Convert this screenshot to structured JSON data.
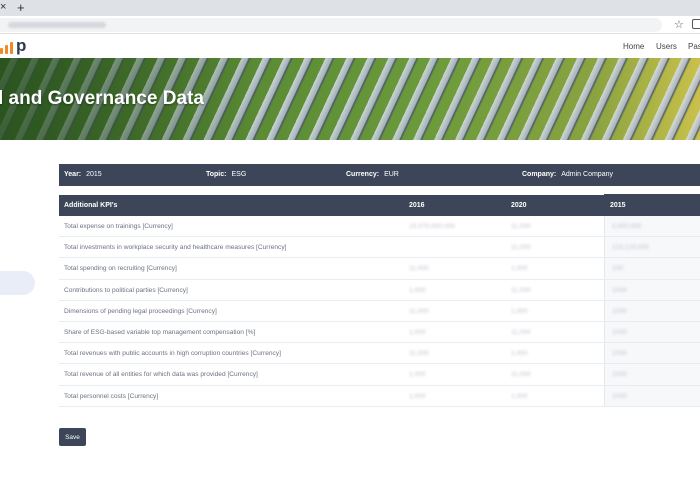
{
  "browser": {
    "close_glyph": "×",
    "newtab_glyph": "+",
    "star_glyph": "☆"
  },
  "nav": {
    "logo_text": "p",
    "links": [
      "Home",
      "Users",
      "Pass"
    ]
  },
  "hero": {
    "title": "l and Governance Data"
  },
  "filters": {
    "year_label": "Year:",
    "year_value": "2015",
    "topic_label": "Topic:",
    "topic_value": "ESG",
    "currency_label": "Currency:",
    "currency_value": "EUR",
    "company_label": "Company:",
    "company_value": "Admin Company"
  },
  "table": {
    "headers": [
      "Additional KPI's",
      "2016",
      "2020",
      "2015"
    ],
    "rows": [
      {
        "label": "Total expense on trainings [Currency]",
        "v2016": "19,370,000,000",
        "v2020": "11,000",
        "v2015": "0,000,000"
      },
      {
        "label": "Total investments in workplace security and healthcare measures [Currency]",
        "v2016": "",
        "v2020": "11,000",
        "v2015": "123,123,000"
      },
      {
        "label": "Total spending on recruiting [Currency]",
        "v2016": "11,000",
        "v2020": "1,000",
        "v2015": "100"
      },
      {
        "label": "Contributions to political parties [Currency]",
        "v2016": "1,000",
        "v2020": "11,000",
        "v2015": "1000"
      },
      {
        "label": "Dimensions of pending legal proceedings [Currency]",
        "v2016": "11,000",
        "v2020": "1,000",
        "v2015": "1000"
      },
      {
        "label": "Share of ESG-based variable top management compensation [%]",
        "v2016": "1,000",
        "v2020": "11,000",
        "v2015": "1000"
      },
      {
        "label": "Total revenues with public accounts in high corruption countries [Currency]",
        "v2016": "11,000",
        "v2020": "1,000",
        "v2015": "1000"
      },
      {
        "label": "Total revenue of all entities for which data was provided [Currency]",
        "v2016": "1,000",
        "v2020": "11,000",
        "v2015": "1000"
      },
      {
        "label": "Total personnel costs [Currency]",
        "v2016": "1,000",
        "v2020": "1,000",
        "v2015": "1000"
      }
    ]
  },
  "actions": {
    "save_label": "Save"
  },
  "colors": {
    "header_bg": "#3c4658",
    "accent": "#f08a24"
  }
}
